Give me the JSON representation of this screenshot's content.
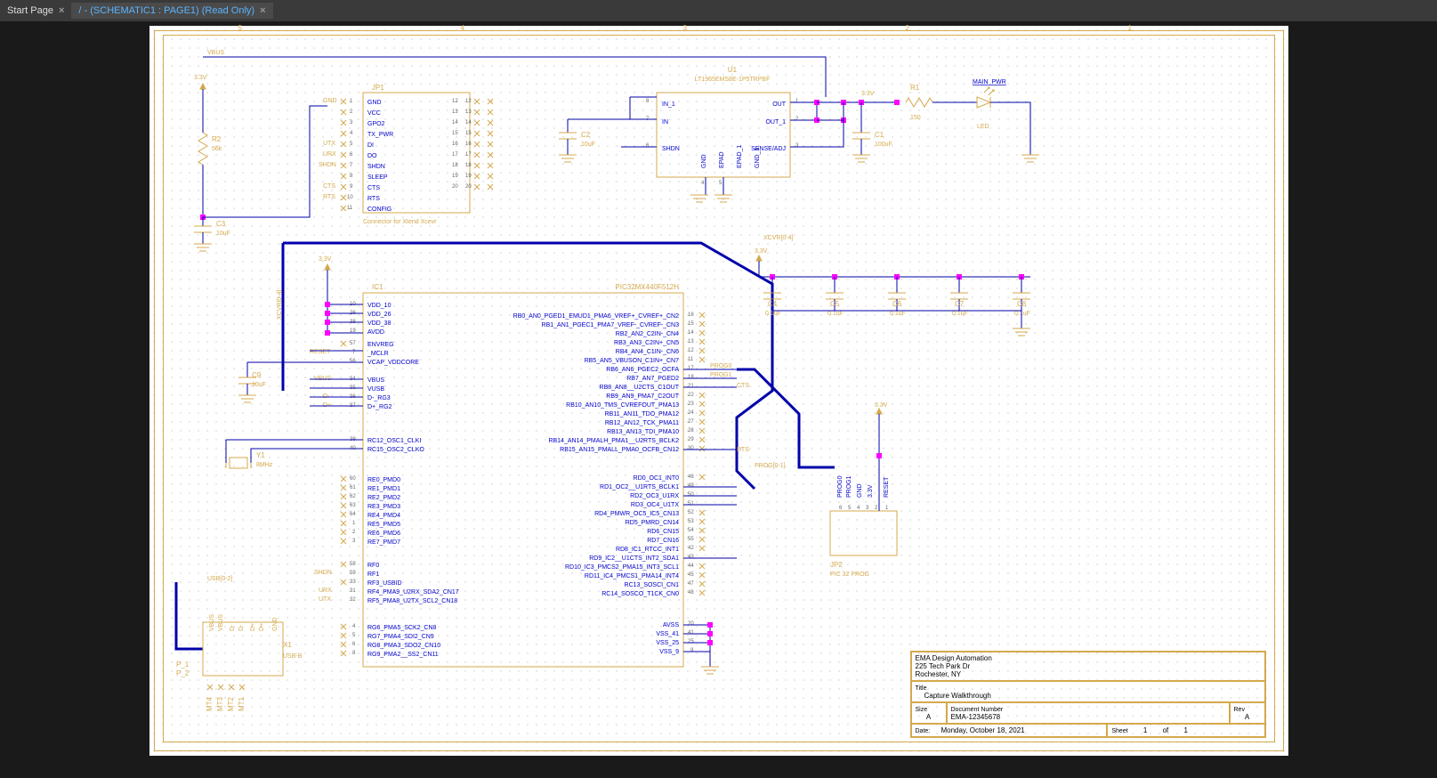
{
  "tabs": {
    "t0": "Start Page",
    "t1": "/ - (SCHEMATIC1 : PAGE1) (Read Only)"
  },
  "ruler": {
    "n5": "5",
    "n4": "4",
    "n3": "3",
    "n2": "2",
    "n1": "1"
  },
  "nets": {
    "vbus": "VBUS",
    "v33": "3.3V",
    "gnd": "GND",
    "utx": "UTX",
    "urx": "URX",
    "shdn": "SHDN",
    "cts": "CTS",
    "rts": "RTS",
    "reset": "RESET",
    "xcvr": "XCVR[0-4]",
    "xcvr_v": "XCVR[0-4]",
    "usb": "USB[0-2]",
    "prog01": "PROG[0-1]",
    "prog0": "PROG0",
    "prog1": "PROG1",
    "main_pwr": "MAIN_PWR",
    "in1": "IN_1",
    "in": "IN",
    "out": "OUT",
    "out1": "OUT_1",
    "sense": "SENSE/ADJ",
    "epad": "EPAD",
    "epad1": "EPAD_1",
    "gnd1": "GND_1",
    "vbus_r": "VBUS",
    "dminus_r": "D-",
    "dplus_r": "D+"
  },
  "refdes": {
    "r1": "R1",
    "r2": "R2",
    "c1": "C1",
    "c2": "C2",
    "c3": "C3",
    "c4": "C4",
    "c5": "C5",
    "c6": "C6",
    "c7": "C7",
    "c8": "C8",
    "c9": "C9",
    "u1": "U1",
    "ic1": "IC1",
    "jp1": "JP1",
    "jp2": "JP2",
    "x1": "X1",
    "y1": "Y1",
    "led": "LED",
    "p1": "P_1",
    "p2": "P_2",
    "mt1": "MT1",
    "mt2": "MT2",
    "mt3": "MT3",
    "mt4": "MT4"
  },
  "values": {
    "r1": "150",
    "r2": "56k",
    "c1": "100uF",
    "c2": "10uF",
    "c3": "10uF",
    "c9": "10uF",
    "c4": "0.1uF",
    "c5": "0.1uF",
    "c6": "0.1uF",
    "c7": "0.1uF",
    "c8": "0.1uF",
    "u1": "LT1965EMS8E-1P5TRPBF",
    "ic1": "PIC32MX440F512H",
    "y1": "8MHz",
    "x1": "USB-B",
    "jp1_note": "Connector for Xtend Xcevr",
    "jp2_note": "PIC 32 PROG"
  },
  "jp1_left": {
    "p1": "GND",
    "p2": "VCC",
    "p3": "GPO2",
    "p4": "TX_PWR",
    "p5": "DI",
    "p6": "DO",
    "p7": "SHDN",
    "p8": "SLEEP",
    "p9": "CTS",
    "p10": "RTS",
    "p11": "CONFIG"
  },
  "jp1_nums": {
    "n1": "1",
    "n2": "2",
    "n3": "3",
    "n4": "4",
    "n5": "5",
    "n6": "6",
    "n7": "7",
    "n8": "8",
    "n9": "9",
    "n10": "10",
    "n11": "11",
    "n12": "12",
    "n13": "13",
    "n14": "14",
    "n15": "15",
    "n16": "16",
    "n17": "17",
    "n18": "18",
    "n19": "19",
    "n20": "20"
  },
  "u1_pins": {
    "p8": "8",
    "p7": "7",
    "p6": "6",
    "p5": "5",
    "p4": "4",
    "p1": "1",
    "p2": "2",
    "p3": "3"
  },
  "ic1_left": {
    "vdd10": "VDD_10",
    "vdd26": "VDD_26",
    "vdd38": "VDD_38",
    "avdd": "AVDD",
    "envreg": "ENVREG",
    "mclr": "_MCLR",
    "vcap": "VCAP_VDDCORE",
    "vbus": "VBUS",
    "vusb": "VUSB",
    "dmrg3": "D-_RG3",
    "dprg2": "D+_RG2",
    "rc12": "RC12_OSC1_CLKI",
    "rc15": "RC15_OSC2_CLKO",
    "re0": "RE0_PMD0",
    "re1": "RE1_PMD1",
    "re2": "RE2_PMD2",
    "re3": "RE3_PMD3",
    "re4": "RE4_PMD4",
    "re5": "RE5_PMD5",
    "re6": "RE6_PMD6",
    "re7": "RE7_PMD7",
    "rf0": "RF0",
    "rf1": "RF1",
    "rf3": "RF3_USBID",
    "rf4": "RF4_PMA9_U2RX_SDA2_CN17",
    "rf5": "RF5_PMA8_U2TX_SCL2_CN18",
    "rg6": "RG6_PMA5_SCK2_CN8",
    "rg7": "RG7_PMA4_SDI2_CN9",
    "rg8": "RG8_PMA3_SDO2_CN10",
    "rg9": "RG9_PMA2__SS2_CN11"
  },
  "ic1_left_nums": {
    "n10": "10",
    "n26": "26",
    "n38": "38",
    "n19": "19",
    "n57": "57",
    "n7": "7",
    "n56": "56",
    "n34": "34",
    "n35": "35",
    "n36": "36",
    "n37": "37",
    "n39": "39",
    "n40": "40",
    "n60": "60",
    "n61": "61",
    "n62": "62",
    "n63": "63",
    "n64": "64",
    "n1": "1",
    "n2": "2",
    "n3": "3",
    "n58": "58",
    "n59": "59",
    "n33": "33",
    "n31": "31",
    "n32": "32",
    "n4": "4",
    "n5": "5",
    "n6": "6",
    "n8": "8"
  },
  "ic1_right": {
    "rb0": "RB0_AN0_PGED1_EMUD1_PMA6_VREF+_CVREF+_CN2",
    "rb1": "RB1_AN1_PGEC1_PMA7_VREF-_CVREF-_CN3",
    "rb2": "RB2_AN2_C2IN-_CN4",
    "rb3": "RB3_AN3_C2IN+_CN5",
    "rb4": "RB4_AN4_C1IN-_CN6",
    "rb5": "RB5_AN5_VBUSON_C1IN+_CN7",
    "rb6": "RB6_AN6_PGEC2_OCFA",
    "rb7": "RB7_AN7_PGED2",
    "rb8": "RB8_AN8__U2CTS_C1OUT",
    "rb9": "RB9_AN9_PMA7_C2OUT",
    "rb10": "RB10_AN10_TMS_CVREFOUT_PMA13",
    "rb11": "RB11_AN11_TDO_PMA12",
    "rb12": "RB12_AN12_TCK_PMA11",
    "rb13": "RB13_AN13_TDI_PMA10",
    "rb14": "RB14_AN14_PMALH_PMA1__U2RTS_BCLK2",
    "rb15": "RB15_AN15_PMALL_PMA0_OCFB_CN12",
    "rd0": "RD0_OC1_INT0",
    "rd1": "RD1_OC2__U1RTS_BCLK1",
    "rd2": "RD2_OC3_U1RX",
    "rd3": "RD3_OC4_U1TX",
    "rd4": "RD4_PMWR_OC5_IC5_CN13",
    "rd5": "RD5_PMRD_CN14",
    "rd6": "RD6_CN15",
    "rd7": "RD7_CN16",
    "rd8": "RD8_IC1_RTCC_INT1",
    "rd9": "RD9_IC2__U1CTS_INT2_SDA1",
    "rd10": "RD10_IC3_PMCS2_PMA15_INT3_SCL1",
    "rd11": "RD11_IC4_PMCS1_PMA14_INT4",
    "rc13": "RC13_SOSCI_CN1",
    "rc14": "RC14_SOSCO_T1CK_CN0",
    "avss": "AVSS",
    "vss41": "VSS_41",
    "vss25": "VSS_25",
    "vss9": "VSS_9"
  },
  "ic1_right_nums": {
    "n16": "16",
    "n15": "15",
    "n14": "14",
    "n13": "13",
    "n12": "12",
    "n11": "11",
    "n17": "17",
    "n18": "18",
    "n21": "21",
    "n22": "22",
    "n23": "23",
    "n24": "24",
    "n27": "27",
    "n28": "28",
    "n29": "29",
    "n30": "30",
    "n46": "46",
    "n49": "49",
    "n50": "50",
    "n51": "51",
    "n52": "52",
    "n53": "53",
    "n54": "54",
    "n55": "55",
    "n42": "42",
    "n43": "43",
    "n44": "44",
    "n45": "45",
    "n47": "47",
    "n48": "48",
    "n20": "20",
    "n41": "41",
    "n25": "25",
    "n9": "9"
  },
  "jp2_pins": {
    "p1": "1",
    "p2": "2",
    "p3": "3",
    "p4": "4",
    "p5": "5",
    "p6": "6",
    "reset": "RESET",
    "v33": "3.3V",
    "gnd": "GND",
    "prog0": "PROG0",
    "prog1": "PROG1"
  },
  "title_block": {
    "company": "EMA Design Automation",
    "addr1": "225 Tech Park Dr",
    "addr2": "Rochester, NY",
    "title_lbl": "Title",
    "title": "Capture Walkthrough",
    "size_lbl": "Size",
    "size": "A",
    "docnum_lbl": "Document Number",
    "docnum": "EMA-12345678",
    "rev_lbl": "Rev",
    "rev": "A",
    "date_lbl": "Date:",
    "date": "Monday, October 18, 2021",
    "sheet_lbl": "Sheet",
    "sheet_n": "1",
    "sheet_of": "of",
    "sheet_tot": "1"
  }
}
